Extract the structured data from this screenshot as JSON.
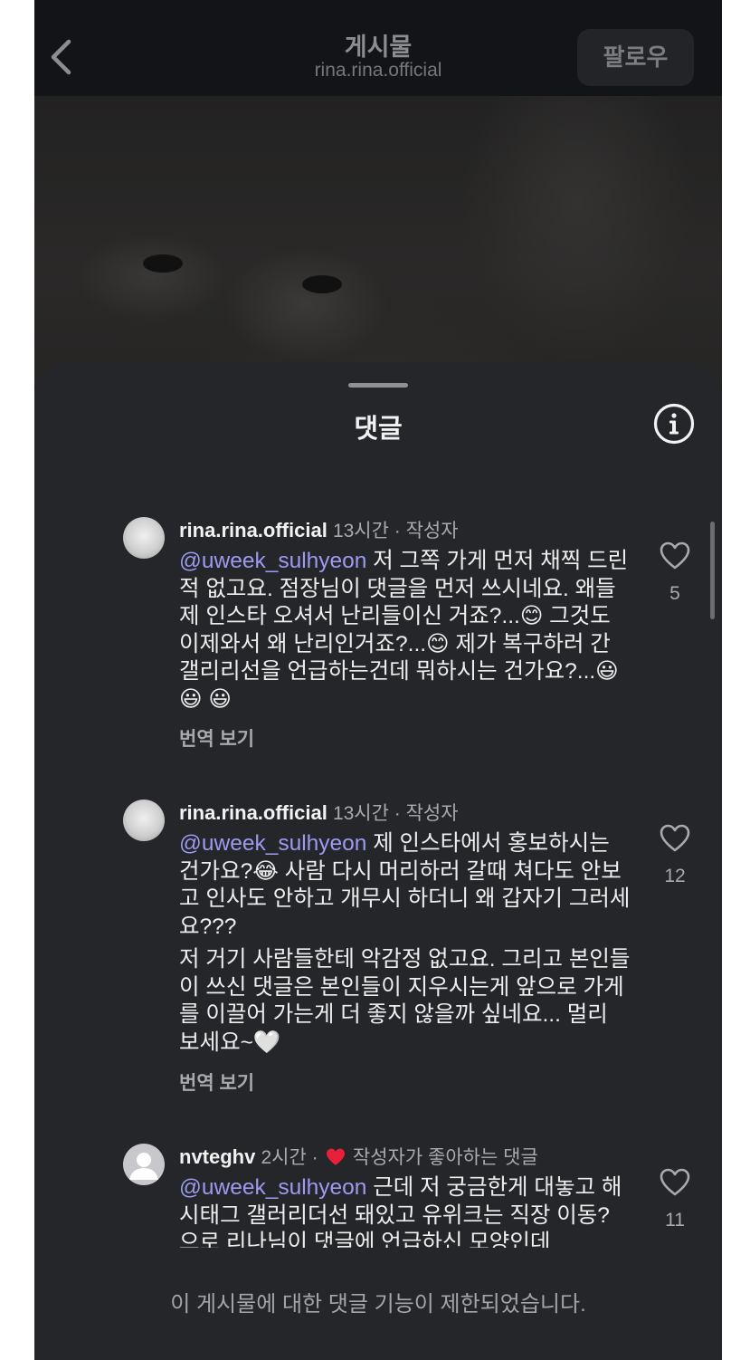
{
  "header": {
    "title": "게시물",
    "subtitle": "rina.rina.official",
    "follow_label": "팔로우",
    "back_icon": "chevron-left-icon"
  },
  "sheet": {
    "title": "댓글",
    "info_icon": "info-icon"
  },
  "comments": [
    {
      "username": "rina.rina.official",
      "meta": "13시간 · 작성자",
      "mention": "@uweek_sulhyeon",
      "paragraphs": [
        "저 그쪽 가게 먼저 채찍 드린적 없고요. 점장님이 댓글을 먼저 쓰시네요. 왜들 제 인스타 오셔서 난리들이신 거죠?...😊 그것도 이제와서 왜 난리인거죠?...😊 제가 복구하러 간 갤리리선을 언급하는건데 뭐하시는 건가요?...😃 😃 😃"
      ],
      "translate": "번역 보기",
      "likes": "5"
    },
    {
      "username": "rina.rina.official",
      "meta": "13시간 · 작성자",
      "mention": "@uweek_sulhyeon",
      "paragraphs": [
        "제 인스타에서 홍보하시는 건가요?😂 사람 다시 머리하러 갈때 쳐다도 안보고 인사도 안하고 개무시 하더니 왜 갑자기 그러세요???",
        "저 거기 사람들한테 악감정 없고요. 그리고 본인들이 쓰신 댓글은 본인들이 지우시는게 앞으로 가게를 이끌어 가는게 더 좋지 않을까 싶네요... 멀리 보세요~🤍"
      ],
      "translate": "번역 보기",
      "likes": "12"
    },
    {
      "username": "nvteghv",
      "meta_time": "2시간 ·",
      "meta_liked": "작성자가 좋아하는 댓글",
      "mention": "@uweek_sulhyeon",
      "paragraphs": [
        "근데 저 궁금한게 대놓고 해시태그 갤러리더선 돼있고 유위크는 직장 이동? 으로 리나님이 댓글에 언급하신 모양인데"
      ],
      "likes": "11"
    }
  ],
  "footer": {
    "note": "이 게시물에 대한 댓글 기능이 제한되었습니다."
  },
  "colors": {
    "sheet_bg": "#24262a",
    "mention": "#9b9bf0",
    "liked_heart": "#e8203a"
  }
}
